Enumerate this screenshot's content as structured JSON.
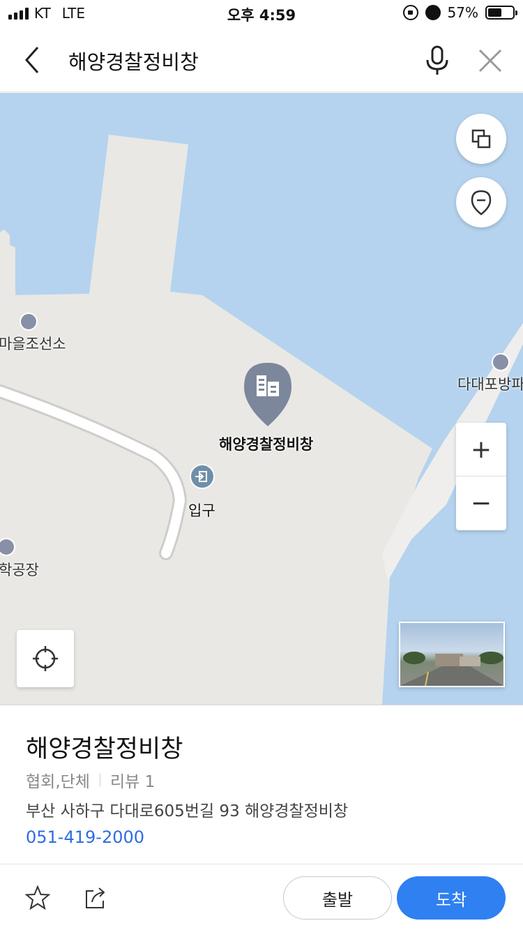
{
  "status_bar": {
    "carrier": "KT",
    "network": "LTE",
    "time": "오후 4:59",
    "battery": "57%",
    "battery_level": 0.57
  },
  "search": {
    "query": "해양경찰정비창"
  },
  "map": {
    "labels": {
      "shipyard": "마을조선소",
      "ferry_terminal": "다대포방파",
      "selected_place": "해양경찰정비창",
      "entrance": "입구",
      "factory": "학공장"
    },
    "zoom_in": "+",
    "zoom_out": "−"
  },
  "place": {
    "name": "해양경찰정비창",
    "category": "협회,단체",
    "review_label": "리뷰 1",
    "address": "부산 사하구 다대로605번길 93 해양경찰정비창",
    "phone": "051-419-2000"
  },
  "actions": {
    "depart": "출발",
    "arrive": "도착"
  },
  "colors": {
    "water": "#b5d3ee",
    "land": "#e9e8e5",
    "accent": "#2f80f0",
    "phone_link": "#2e6ce0"
  }
}
